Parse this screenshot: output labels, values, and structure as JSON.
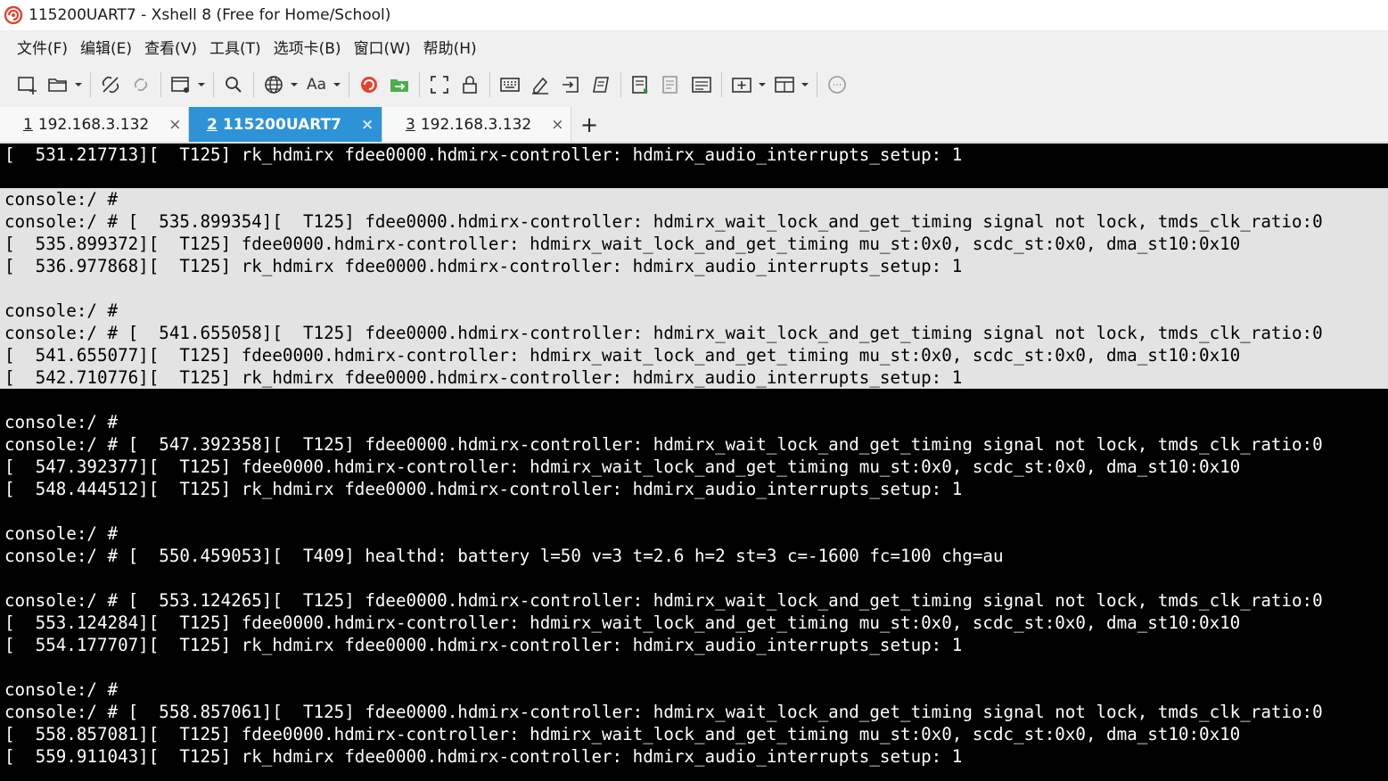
{
  "window": {
    "title": "115200UART7 - Xshell 8 (Free for Home/School)",
    "colors": {
      "selection_bg": "#e3e3e3",
      "terminal_bg": "#000000",
      "terminal_fg": "#ffffff",
      "active_tab": "#2e92d6",
      "connected_dot": "#1cc13b"
    }
  },
  "menu": [
    "文件(F)",
    "编辑(E)",
    "查看(V)",
    "工具(T)",
    "选项卡(B)",
    "窗口(W)",
    "帮助(H)"
  ],
  "toolbar": {
    "icons": [
      "new-session-icon",
      "open-folder-icon",
      "disconnect-icon",
      "reconnect-icon",
      "new-window-icon",
      "search-icon",
      "globe-icon",
      "font-icon",
      "xshell-logo-icon",
      "xftp-icon",
      "fullscreen-icon",
      "lock-icon",
      "keyboard-icon",
      "highlight-icon",
      "send-icon",
      "script-icon",
      "log-icon",
      "transfer-icon",
      "compose-icon",
      "new-tab-icon",
      "layout-icon",
      "chat-icon"
    ],
    "font_label": "Aa"
  },
  "tabs": [
    {
      "num": "1",
      "label": "192.168.3.132",
      "close": "×"
    },
    {
      "num": "2",
      "label": "115200UART7",
      "close": "×"
    },
    {
      "num": "3",
      "label": "192.168.3.132",
      "close": "×"
    }
  ],
  "tab_add": "+",
  "terminal": {
    "lines": [
      {
        "text": "[  531.217713][  T125] rk_hdmirx fdee0000.hdmirx-controller: hdmirx_audio_interrupts_setup: 1",
        "selected": false
      },
      {
        "text": "",
        "selected": false
      },
      {
        "text": "console:/ #",
        "selected": true
      },
      {
        "text": "console:/ # [  535.899354][  T125] fdee0000.hdmirx-controller: hdmirx_wait_lock_and_get_timing signal not lock, tmds_clk_ratio:0",
        "selected": true
      },
      {
        "text": "[  535.899372][  T125] fdee0000.hdmirx-controller: hdmirx_wait_lock_and_get_timing mu_st:0x0, scdc_st:0x0, dma_st10:0x10",
        "selected": true
      },
      {
        "text": "[  536.977868][  T125] rk_hdmirx fdee0000.hdmirx-controller: hdmirx_audio_interrupts_setup: 1",
        "selected": true
      },
      {
        "text": "",
        "selected": true
      },
      {
        "text": "console:/ #",
        "selected": true
      },
      {
        "text": "console:/ # [  541.655058][  T125] fdee0000.hdmirx-controller: hdmirx_wait_lock_and_get_timing signal not lock, tmds_clk_ratio:0",
        "selected": true
      },
      {
        "text": "[  541.655077][  T125] fdee0000.hdmirx-controller: hdmirx_wait_lock_and_get_timing mu_st:0x0, scdc_st:0x0, dma_st10:0x10",
        "selected": true
      },
      {
        "text": "[  542.710776][  T125] rk_hdmirx fdee0000.hdmirx-controller: hdmirx_audio_interrupts_setup: 1",
        "selected": true
      },
      {
        "text": "",
        "selected": false
      },
      {
        "text": "console:/ #",
        "selected": false
      },
      {
        "text": "console:/ # [  547.392358][  T125] fdee0000.hdmirx-controller: hdmirx_wait_lock_and_get_timing signal not lock, tmds_clk_ratio:0",
        "selected": false
      },
      {
        "text": "[  547.392377][  T125] fdee0000.hdmirx-controller: hdmirx_wait_lock_and_get_timing mu_st:0x0, scdc_st:0x0, dma_st10:0x10",
        "selected": false
      },
      {
        "text": "[  548.444512][  T125] rk_hdmirx fdee0000.hdmirx-controller: hdmirx_audio_interrupts_setup: 1",
        "selected": false
      },
      {
        "text": "",
        "selected": false
      },
      {
        "text": "console:/ #",
        "selected": false
      },
      {
        "text": "console:/ # [  550.459053][  T409] healthd: battery l=50 v=3 t=2.6 h=2 st=3 c=-1600 fc=100 chg=au",
        "selected": false
      },
      {
        "text": "",
        "selected": false
      },
      {
        "text": "console:/ # [  553.124265][  T125] fdee0000.hdmirx-controller: hdmirx_wait_lock_and_get_timing signal not lock, tmds_clk_ratio:0",
        "selected": false
      },
      {
        "text": "[  553.124284][  T125] fdee0000.hdmirx-controller: hdmirx_wait_lock_and_get_timing mu_st:0x0, scdc_st:0x0, dma_st10:0x10",
        "selected": false
      },
      {
        "text": "[  554.177707][  T125] rk_hdmirx fdee0000.hdmirx-controller: hdmirx_audio_interrupts_setup: 1",
        "selected": false
      },
      {
        "text": "",
        "selected": false
      },
      {
        "text": "console:/ #",
        "selected": false
      },
      {
        "text": "console:/ # [  558.857061][  T125] fdee0000.hdmirx-controller: hdmirx_wait_lock_and_get_timing signal not lock, tmds_clk_ratio:0",
        "selected": false
      },
      {
        "text": "[  558.857081][  T125] fdee0000.hdmirx-controller: hdmirx_wait_lock_and_get_timing mu_st:0x0, scdc_st:0x0, dma_st10:0x10",
        "selected": false
      },
      {
        "text": "[  559.911043][  T125] rk_hdmirx fdee0000.hdmirx-controller: hdmirx_audio_interrupts_setup: 1",
        "selected": false
      }
    ]
  }
}
